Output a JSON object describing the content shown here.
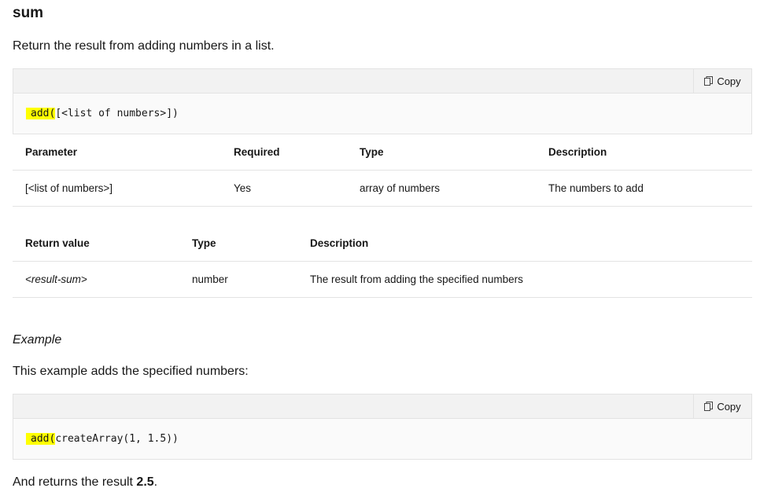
{
  "heading": "sum",
  "intro": "Return the result from adding numbers in a list.",
  "copy_label": "Copy",
  "syntax": {
    "fn": "add(",
    "args": "[<list of numbers>])"
  },
  "params_table": {
    "headers": [
      "Parameter",
      "Required",
      "Type",
      "Description"
    ],
    "rows": [
      [
        "[<list of numbers>]",
        "Yes",
        "array of numbers",
        "The numbers to add"
      ]
    ]
  },
  "return_table": {
    "headers": [
      "Return value",
      "Type",
      "Description"
    ],
    "rows": [
      [
        "<result-sum>",
        "number",
        "The result from adding the specified numbers"
      ]
    ]
  },
  "example_label": "Example",
  "example_intro": "This example adds the specified numbers:",
  "example_code": {
    "fn": "add(",
    "args": "createArray(1, 1.5))"
  },
  "result_text": "And returns the result ",
  "result_value": "2.5",
  "result_end": "."
}
